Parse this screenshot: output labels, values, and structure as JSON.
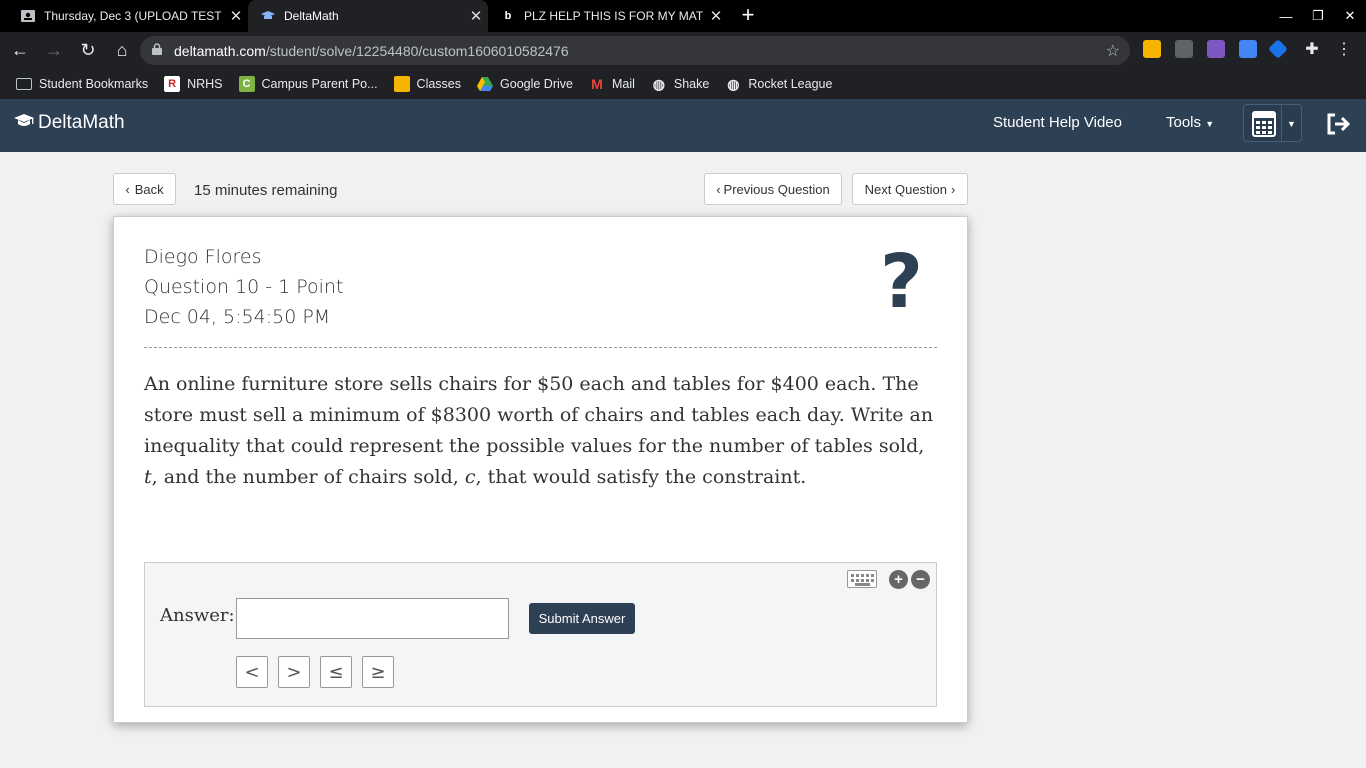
{
  "browser": {
    "tabs": [
      {
        "title": "Thursday, Dec 3 (UPLOAD TEST",
        "icon": "classroom-icon",
        "active": false
      },
      {
        "title": "DeltaMath",
        "icon": "deltamath-icon",
        "active": true
      },
      {
        "title": "PLZ HELP THIS IS FOR MY MATH",
        "icon": "brainly-icon",
        "active": false
      }
    ],
    "new_tab": "+",
    "url_host": "deltamath.com",
    "url_path": "/student/solve/12254480/custom1606010582476",
    "bookmarks": [
      {
        "label": "Student Bookmarks",
        "icon": "folder-icon"
      },
      {
        "label": "NRHS",
        "icon": "nrhs-icon"
      },
      {
        "label": "Campus Parent Po...",
        "icon": "campus-icon"
      },
      {
        "label": "Classes",
        "icon": "classroom-icon"
      },
      {
        "label": "Google Drive",
        "icon": "drive-icon"
      },
      {
        "label": "Mail",
        "icon": "gmail-icon"
      },
      {
        "label": "Shake",
        "icon": "globe-icon"
      },
      {
        "label": "Rocket League",
        "icon": "globe-icon"
      }
    ]
  },
  "app": {
    "brand": "DeltaMath",
    "help_video": "Student Help Video",
    "tools": "Tools",
    "accent": "#2d4054"
  },
  "controls": {
    "back": "Back",
    "timer": "15 minutes remaining",
    "previous": "Previous Question",
    "next": "Next Question"
  },
  "question": {
    "student": "Diego Flores",
    "number": "Question 10 - 1 Point",
    "date": "Dec 04, 5:54:50 PM",
    "text_1": "An online furniture store sells chairs for $50 each and tables for $400 each. The store must sell a minimum of $8300 worth of chairs and tables each day. Write an inequality that could represent the possible values for the number of tables sold, ",
    "var_t": "t",
    "text_2": ", and the number of chairs sold, ",
    "var_c": "c",
    "text_3": ", that would satisfy the constraint."
  },
  "answer": {
    "label": "Answer:",
    "value": "",
    "submit": "Submit Answer",
    "symbols": [
      "<",
      ">",
      "≤",
      "≥"
    ]
  }
}
